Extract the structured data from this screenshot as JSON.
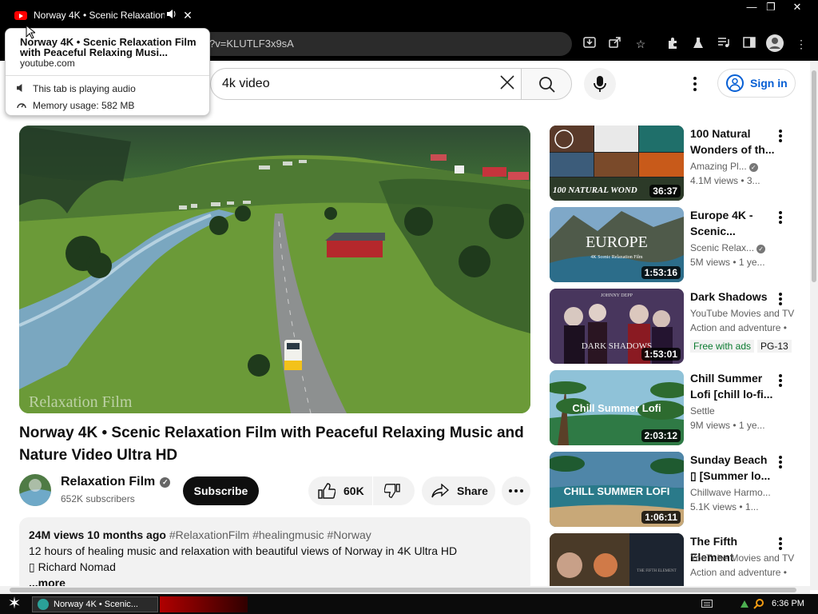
{
  "browser": {
    "tab_title": "Norway 4K • Scenic Relaxation",
    "address_visible": "?v=KLUTLF3x9sA",
    "hovercard": {
      "title": "Norway 4K • Scenic Relaxation Film with Peaceful Relaxing Musi...",
      "domain": "youtube.com",
      "audio_status": "This tab is playing audio",
      "memory": "Memory usage: 582 MB"
    }
  },
  "header": {
    "search_value": "4k video",
    "signin_label": "Sign in"
  },
  "video": {
    "watermark": "Relaxation Film",
    "title": "Norway 4K • Scenic Relaxation Film with Peaceful Relaxing Music and Nature Video Ultra HD",
    "channel": "Relaxation Film",
    "subscribers": "652K subscribers",
    "subscribe_label": "Subscribe",
    "likes": "60K",
    "share_label": "Share",
    "description": {
      "meta": "24M views  10 months ago",
      "tags": "#RelaxationFilm #healingmusic #Norway",
      "line1": "12 hours of healing music and relaxation with beautiful views of Norway in 4K Ultra HD",
      "line2": "▯ Richard Nomad",
      "more": "...more"
    }
  },
  "recommendations": [
    {
      "title": "100 Natural Wonders of th...",
      "channel": "Amazing Pl...",
      "verified": true,
      "views": "4.1M views  • 3...",
      "duration": "36:37",
      "thumb_text": "100 NATURAL WOND"
    },
    {
      "title": "Europe 4K - Scenic...",
      "channel": "Scenic Relax...",
      "verified": true,
      "views": "5M views  • 1 ye...",
      "duration": "1:53:16",
      "thumb_text": "EUROPE",
      "thumb_sub": "4K Scenic Relaxation Film"
    },
    {
      "title": "Dark Shadows",
      "channel": "YouTube Movies and TV",
      "views": "Action and adventure •",
      "duration": "1:53:01",
      "thumb_text": "DARK SHADOWS",
      "thumb_top": "JOHNNY DEPP",
      "badges": [
        "Free with ads",
        "PG-13"
      ]
    },
    {
      "title": "Chill Summer Lofi [chill lo-fi...",
      "channel": "Settle",
      "views": "9M views  • 1 ye...",
      "duration": "2:03:12",
      "thumb_text": "Chill Summer Lofi"
    },
    {
      "title": "Sunday Beach ▯ [Summer lo...",
      "channel": "Chillwave Harmo...",
      "views": "5.1K views  • 1...",
      "duration": "1:06:11",
      "thumb_text": "CHILL SUMMER LOFI"
    },
    {
      "title": "The Fifth Element",
      "channel": "YouTube Movies and TV",
      "views": "Action and adventure •",
      "thumb_text": "THE FIFTH ELEMENT"
    }
  ],
  "taskbar": {
    "task_label": "Norway 4K • Scenic...",
    "clock": "6:36 PM"
  }
}
